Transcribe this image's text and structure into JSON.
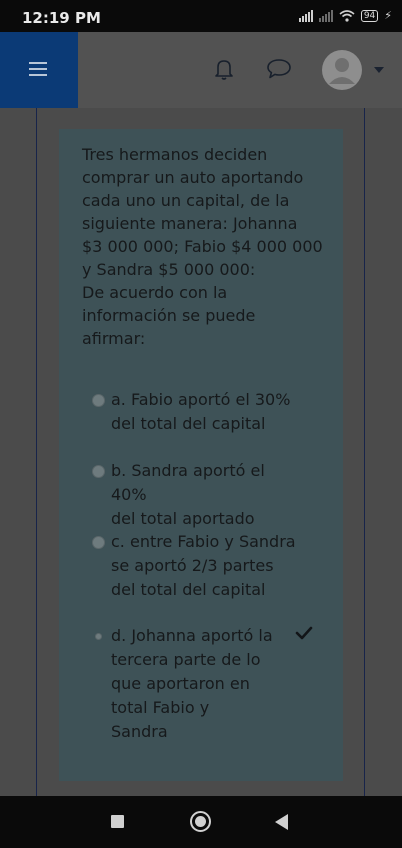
{
  "status_bar": {
    "time": "12:19 PM",
    "battery": "94",
    "icons": [
      "signal-icon",
      "signal-weak-icon",
      "wifi-icon",
      "battery-icon",
      "charging-icon"
    ]
  },
  "header": {
    "icons": [
      "menu-icon",
      "bell-icon",
      "chat-icon",
      "avatar",
      "chevron-down-icon"
    ],
    "accent_color": "#0b3a76"
  },
  "question": {
    "text": "Tres hermanos deciden\ncomprar un auto aportando\ncada uno un capital, de la\nsiguiente manera: Johanna\n$3 000 000; Fabio $4 000 000\ny Sandra $5 000 000:\nDe acuerdo con la\ninformación se puede\nafirmar:"
  },
  "options": [
    {
      "label": "a. Fabio aportó el 30%\ndel total del capital",
      "selected": false,
      "correct": false
    },
    {
      "label": "b. Sandra aportó el 40%\ndel total aportado",
      "selected": false,
      "correct": false
    },
    {
      "label": "c. entre Fabio y Sandra\nse aportó 2/3 partes\ndel total del capital",
      "selected": false,
      "correct": false
    },
    {
      "label": "d. Johanna aportó la\ntercera parte de lo\nque aportaron en\ntotal Fabio y\nSandra",
      "selected": true,
      "correct": true
    }
  ],
  "nav_bar": {
    "icons": [
      "recent-apps-icon",
      "home-icon",
      "back-icon"
    ]
  }
}
